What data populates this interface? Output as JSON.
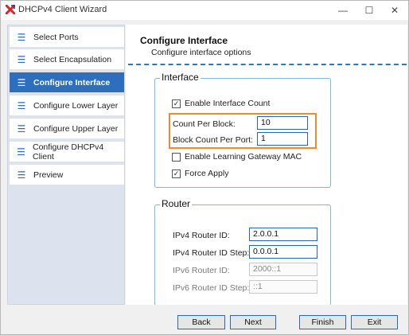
{
  "window": {
    "title": "DHCPv4 Client Wizard",
    "controls": {
      "minimize": "—",
      "maximize": "☐",
      "close": "✕"
    }
  },
  "sidebar": {
    "items": [
      {
        "label": "Select Ports",
        "icon": "menu-icon",
        "active": false
      },
      {
        "label": "Select Encapsulation",
        "icon": "menu-icon",
        "active": false
      },
      {
        "label": "Configure Interface",
        "icon": "menu-icon",
        "active": true
      },
      {
        "label": "Configure Lower Layer",
        "icon": "menu-icon",
        "active": false
      },
      {
        "label": "Configure Upper Layer",
        "icon": "menu-icon",
        "active": false
      },
      {
        "label": "Configure DHCPv4 Client",
        "icon": "menu-icon",
        "active": false
      },
      {
        "label": "Preview",
        "icon": "menu-icon",
        "active": false
      }
    ]
  },
  "main": {
    "title": "Configure Interface",
    "subtitle": "Configure interface options",
    "interface_group": {
      "title": "Interface",
      "enable_interface_count": {
        "label": "Enable Interface Count",
        "checked": true
      },
      "count_per_block": {
        "label": "Count Per Block:",
        "value": "10"
      },
      "block_count_per_port": {
        "label": "Block Count Per Port:",
        "value": "1"
      },
      "enable_learning_gateway_mac": {
        "label": "Enable Learning Gateway MAC",
        "checked": false
      },
      "force_apply": {
        "label": "Force Apply",
        "checked": true
      }
    },
    "router_group": {
      "title": "Router",
      "ipv4_router_id": {
        "label": "IPv4 Router ID:",
        "value": "2.0.0.1",
        "enabled": true
      },
      "ipv4_router_id_step": {
        "label": "IPv4 Router ID Step:",
        "value": "0.0.0.1",
        "enabled": true
      },
      "ipv6_router_id": {
        "label": "IPv6 Router ID:",
        "value": "2000::1",
        "enabled": false
      },
      "ipv6_router_id_step": {
        "label": "IPv6 Router ID Step:",
        "value": "::1",
        "enabled": false
      }
    }
  },
  "footer": {
    "back": "Back",
    "next": "Next",
    "finish": "Finish",
    "exit": "Exit"
  },
  "colors": {
    "accent": "#2d6fbd",
    "highlight_border": "#ef8a2f",
    "group_border": "#7fbad8",
    "app_icon_red": "#d9262c"
  },
  "check_mark": "✓"
}
